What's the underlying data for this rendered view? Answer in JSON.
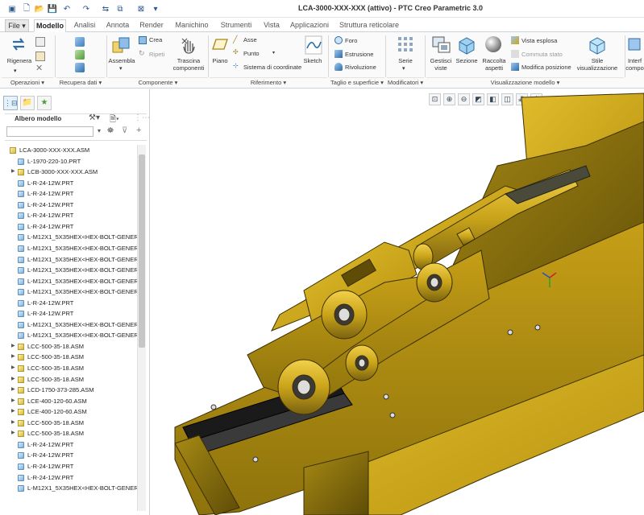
{
  "window": {
    "title": "LCA-3000-XXX-XXX (attivo) - PTC Creo Parametric 3.0"
  },
  "tabs": [
    "File ▾",
    "Modello",
    "Analisi",
    "Annota",
    "Render",
    "Manichino",
    "Strumenti",
    "Vista",
    "Applicazioni",
    "Struttura reticolare"
  ],
  "ribbon": {
    "rigenera": "Rigenera",
    "assembla": "Assembla",
    "crea": "Crea",
    "ripeti": "Ripeti",
    "trascina": "Trascina componenti",
    "piano": "Piano",
    "asse": "Asse",
    "punto": "Punto",
    "sistema": "Sistema di coordinate",
    "sketch": "Sketch",
    "foro": "Foro",
    "estrusione": "Estrusione",
    "rivoluzione": "Rivoluzione",
    "serie": "Serie",
    "gestisci": "Gestisci viste",
    "sezione": "Sezione",
    "raccolta": "Raccolta aspetti",
    "vista_esplosa": "Vista esplosa",
    "commuta": "Commuta stato",
    "modifica_pos": "Modifica posizione",
    "stile": "Stile visualizzazione",
    "interf": "Interf compo",
    "groups": {
      "operazioni": "Operazioni ▾",
      "recupera": "Recupera dati ▾",
      "componente": "Componente ▾",
      "riferimento": "Riferimento ▾",
      "taglio": "Taglio e superficie ▾",
      "modificatori": "Modificatori ▾",
      "visualizzazione": "Visualizzazione modello ▾"
    }
  },
  "panel": {
    "title": "Albero modello",
    "tree": [
      {
        "label": "LCA-3000-XXX-XXX.ASM",
        "type": "asm",
        "indent": 0,
        "expand": ""
      },
      {
        "label": "L-1970-220-10.PRT",
        "type": "prt",
        "indent": 1,
        "expand": ""
      },
      {
        "label": "LCB-3000-XXX-XXX.ASM",
        "type": "asm",
        "indent": 1,
        "expand": "▶"
      },
      {
        "label": "L-R-24-12W.PRT",
        "type": "prt",
        "indent": 1,
        "expand": ""
      },
      {
        "label": "L-R-24-12W.PRT",
        "type": "prt",
        "indent": 1,
        "expand": ""
      },
      {
        "label": "L-R-24-12W.PRT",
        "type": "prt",
        "indent": 1,
        "expand": ""
      },
      {
        "label": "L-R-24-12W.PRT",
        "type": "prt",
        "indent": 1,
        "expand": ""
      },
      {
        "label": "L-R-24-12W.PRT",
        "type": "prt",
        "indent": 1,
        "expand": ""
      },
      {
        "label": "L-M12X1_5X35HEX<HEX-BOLT-GENERIC",
        "type": "prt",
        "indent": 1,
        "expand": ""
      },
      {
        "label": "L-M12X1_5X35HEX<HEX-BOLT-GENERIC",
        "type": "prt",
        "indent": 1,
        "expand": ""
      },
      {
        "label": "L-M12X1_5X35HEX<HEX-BOLT-GENERIC",
        "type": "prt",
        "indent": 1,
        "expand": ""
      },
      {
        "label": "L-M12X1_5X35HEX<HEX-BOLT-GENERIC",
        "type": "prt",
        "indent": 1,
        "expand": ""
      },
      {
        "label": "L-M12X1_5X35HEX<HEX-BOLT-GENERIC",
        "type": "prt",
        "indent": 1,
        "expand": ""
      },
      {
        "label": "L-M12X1_5X35HEX<HEX-BOLT-GENERIC",
        "type": "prt",
        "indent": 1,
        "expand": ""
      },
      {
        "label": "L-R-24-12W.PRT",
        "type": "prt",
        "indent": 1,
        "expand": ""
      },
      {
        "label": "L-R-24-12W.PRT",
        "type": "prt",
        "indent": 1,
        "expand": ""
      },
      {
        "label": "L-M12X1_5X35HEX<HEX-BOLT-GENERIC",
        "type": "prt",
        "indent": 1,
        "expand": ""
      },
      {
        "label": "L-M12X1_5X35HEX<HEX-BOLT-GENERIC",
        "type": "prt",
        "indent": 1,
        "expand": ""
      },
      {
        "label": "LCC-500-35-18.ASM",
        "type": "asm",
        "indent": 1,
        "expand": "▶"
      },
      {
        "label": "LCC-500-35-18.ASM",
        "type": "asm",
        "indent": 1,
        "expand": "▶"
      },
      {
        "label": "LCC-500-35-18.ASM",
        "type": "asm",
        "indent": 1,
        "expand": "▶"
      },
      {
        "label": "LCC-500-35-18.ASM",
        "type": "asm",
        "indent": 1,
        "expand": "▶"
      },
      {
        "label": "LCD-1750-373-285.ASM",
        "type": "asm",
        "indent": 1,
        "expand": "▶"
      },
      {
        "label": "LCE-400-120-60.ASM",
        "type": "asm",
        "indent": 1,
        "expand": "▶"
      },
      {
        "label": "LCE-400-120-60.ASM",
        "type": "asm",
        "indent": 1,
        "expand": "▶"
      },
      {
        "label": "LCC-500-35-18.ASM",
        "type": "asm",
        "indent": 1,
        "expand": "▶"
      },
      {
        "label": "LCC-500-35-18.ASM",
        "type": "asm",
        "indent": 1,
        "expand": "▶"
      },
      {
        "label": "L-R-24-12W.PRT",
        "type": "prt",
        "indent": 1,
        "expand": ""
      },
      {
        "label": "L-R-24-12W.PRT",
        "type": "prt",
        "indent": 1,
        "expand": ""
      },
      {
        "label": "L-R-24-12W.PRT",
        "type": "prt",
        "indent": 1,
        "expand": ""
      },
      {
        "label": "L-R-24-12W.PRT",
        "type": "prt",
        "indent": 1,
        "expand": ""
      },
      {
        "label": "L-M12X1_5X35HEX<HEX-BOLT-GENERIC",
        "type": "prt",
        "indent": 1,
        "expand": ""
      }
    ]
  },
  "colors": {
    "accent": "#2d6da8",
    "model": "#c9a41a",
    "model_dark": "#7a6210",
    "ribbon_bg": "#fafafa"
  }
}
